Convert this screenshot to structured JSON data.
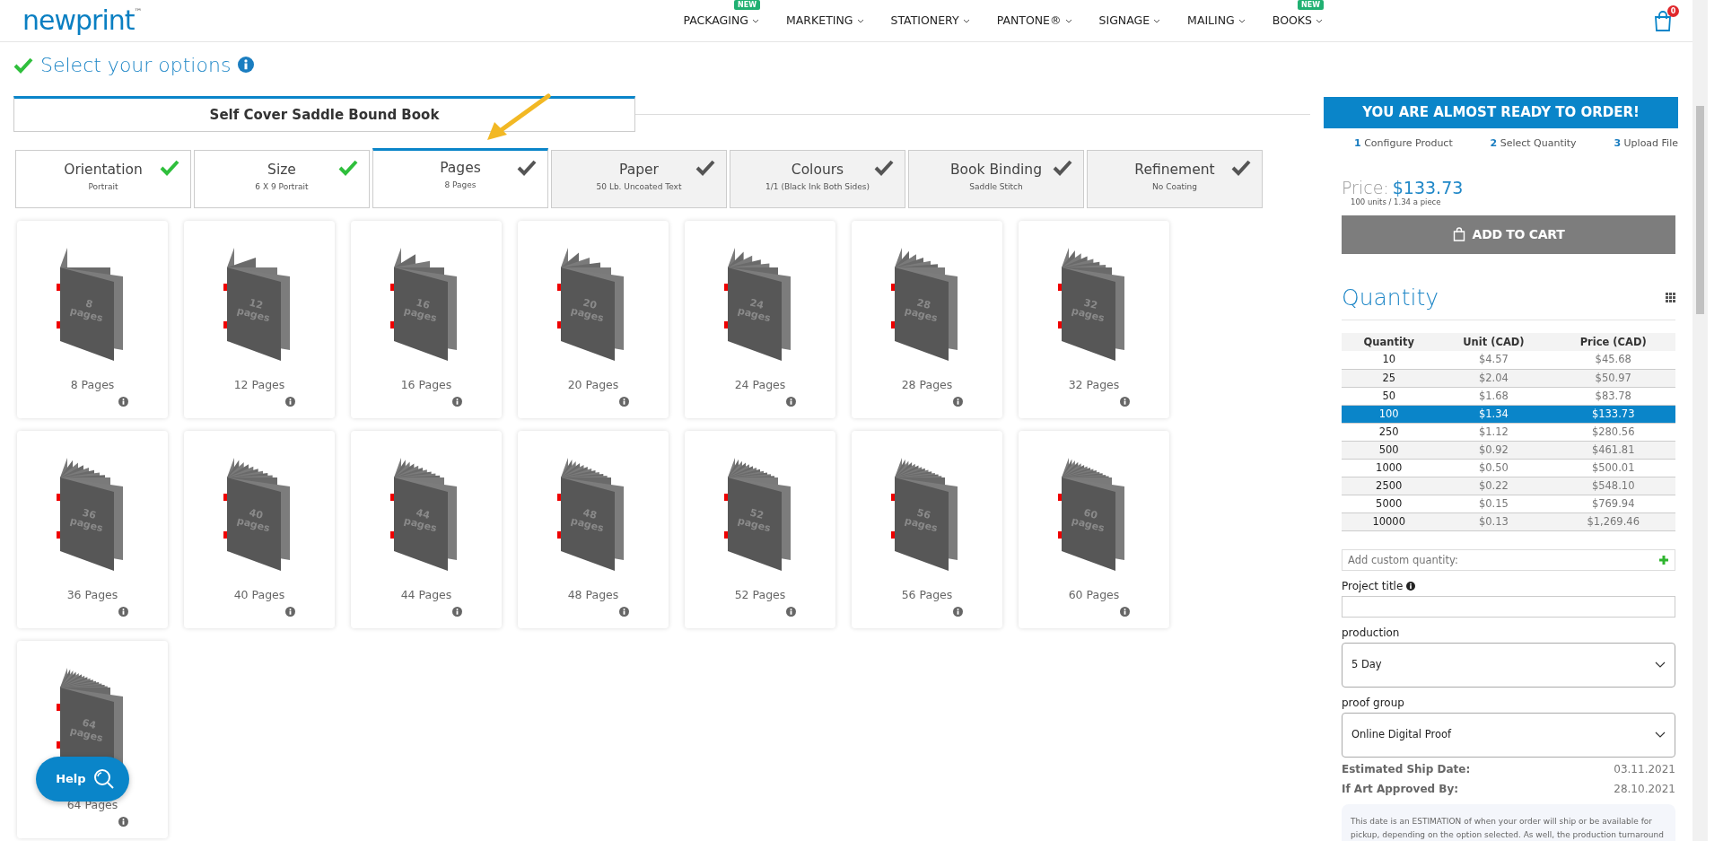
{
  "header": {
    "logo": "newprint",
    "logo_mark": "™",
    "nav": [
      {
        "label": "PACKAGING",
        "badge": "NEW"
      },
      {
        "label": "MARKETING"
      },
      {
        "label": "STATIONERY"
      },
      {
        "label": "PANTONE®"
      },
      {
        "label": "SIGNAGE"
      },
      {
        "label": "MAILING"
      },
      {
        "label": "BOOKS",
        "badge": "NEW"
      }
    ],
    "cart_count": "0"
  },
  "page_title": "Select your options",
  "product_title": "Self Cover Saddle Bound Book",
  "steps": [
    {
      "title": "Orientation",
      "value": "Portrait",
      "done": true,
      "selected": false
    },
    {
      "title": "Size",
      "value": "6 X 9 Portrait",
      "done": true,
      "selected": false
    },
    {
      "title": "Pages",
      "value": "8 Pages",
      "done": false,
      "selected": true
    },
    {
      "title": "Paper",
      "value": "50 Lb. Uncoated Text",
      "done": false,
      "selected": false
    },
    {
      "title": "Colours",
      "value": "1/1 (Black Ink Both Sides)",
      "done": false,
      "selected": false
    },
    {
      "title": "Book Binding",
      "value": "Saddle Stitch",
      "done": false,
      "selected": false
    },
    {
      "title": "Refinement",
      "value": "No Coating",
      "done": false,
      "selected": false
    }
  ],
  "options": [
    {
      "label": "8 Pages",
      "cover_number": "8",
      "cover_word": "pages"
    },
    {
      "label": "12 Pages",
      "cover_number": "12",
      "cover_word": "pages"
    },
    {
      "label": "16 Pages",
      "cover_number": "16",
      "cover_word": "pages"
    },
    {
      "label": "20 Pages",
      "cover_number": "20",
      "cover_word": "pages"
    },
    {
      "label": "24 Pages",
      "cover_number": "24",
      "cover_word": "pages"
    },
    {
      "label": "28 Pages",
      "cover_number": "28",
      "cover_word": "pages"
    },
    {
      "label": "32 Pages",
      "cover_number": "32",
      "cover_word": "pages"
    },
    {
      "label": "36 Pages",
      "cover_number": "36",
      "cover_word": "pages"
    },
    {
      "label": "40 Pages",
      "cover_number": "40",
      "cover_word": "pages"
    },
    {
      "label": "44 Pages",
      "cover_number": "44",
      "cover_word": "pages"
    },
    {
      "label": "48 Pages",
      "cover_number": "48",
      "cover_word": "pages"
    },
    {
      "label": "52 Pages",
      "cover_number": "52",
      "cover_word": "pages"
    },
    {
      "label": "56 Pages",
      "cover_number": "56",
      "cover_word": "pages"
    },
    {
      "label": "60 Pages",
      "cover_number": "60",
      "cover_word": "pages"
    },
    {
      "label": "64 Pages",
      "cover_number": "64",
      "cover_word": "pages"
    }
  ],
  "order": {
    "banner": "YOU ARE ALMOST READY TO ORDER!",
    "steps": [
      {
        "number": "1",
        "label": "Configure Product"
      },
      {
        "number": "2",
        "label": "Select Quantity"
      },
      {
        "number": "3",
        "label": "Upload File"
      }
    ],
    "price_label": "Price:",
    "price": "$133.73",
    "price_note": "100 units / 1.34 a piece",
    "add_to_cart": "ADD TO CART",
    "quantity_title": "Quantity",
    "table": {
      "columns": [
        "Quantity",
        "Unit (CAD)",
        "Price (CAD)"
      ],
      "rows": [
        {
          "cells": [
            "10",
            "$4.57",
            "$45.68"
          ],
          "selected": false
        },
        {
          "cells": [
            "25",
            "$2.04",
            "$50.97"
          ],
          "selected": false
        },
        {
          "cells": [
            "50",
            "$1.68",
            "$83.78"
          ],
          "selected": false
        },
        {
          "cells": [
            "100",
            "$1.34",
            "$133.73"
          ],
          "selected": true
        },
        {
          "cells": [
            "250",
            "$1.12",
            "$280.56"
          ],
          "selected": false
        },
        {
          "cells": [
            "500",
            "$0.92",
            "$461.81"
          ],
          "selected": false
        },
        {
          "cells": [
            "1000",
            "$0.50",
            "$500.01"
          ],
          "selected": false
        },
        {
          "cells": [
            "2500",
            "$0.22",
            "$548.10"
          ],
          "selected": false
        },
        {
          "cells": [
            "5000",
            "$0.15",
            "$769.94"
          ],
          "selected": false
        },
        {
          "cells": [
            "10000",
            "$0.13",
            "$1,269.46"
          ],
          "selected": false
        }
      ]
    },
    "custom_quantity": {
      "placeholder": "Add custom quantity:"
    },
    "project_title_label": "Project title",
    "production": {
      "label": "production",
      "value": "5 Day"
    },
    "proof": {
      "label": "proof group",
      "value": "Online Digital Proof"
    },
    "dates": [
      {
        "label": "Estimated Ship Date:",
        "value": "03.11.2021"
      },
      {
        "label": "If Art Approved By:",
        "value": "28.10.2021"
      }
    ],
    "note": "This date is an ESTIMATION of when your order will ship or be available for pickup, depending on the option selected. As well, the production turnaround"
  },
  "help": "Help"
}
